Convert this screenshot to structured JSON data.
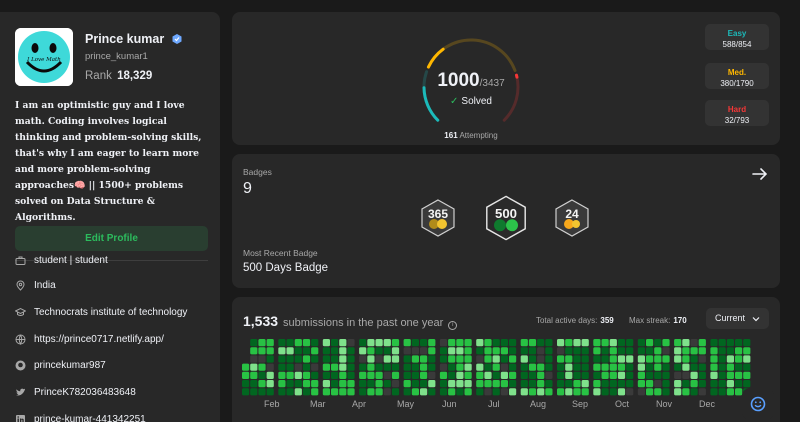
{
  "profile": {
    "name": "Prince kumar",
    "username": "prince_kumar1",
    "rank_label": "Rank",
    "rank_value": "18,329",
    "avatar_caption": "I Love Math",
    "bio": "I am an optimistic guy and I love math. Coding involves logical thinking and problem-solving skills, that's why I am eager to learn more and more problem-solving approaches🧠 || 1500+ problems solved on Data Structure & Algorithms.",
    "edit_button": "Edit Profile",
    "info": [
      {
        "icon": "briefcase-icon",
        "text": "student | student"
      },
      {
        "icon": "location-icon",
        "text": "India"
      },
      {
        "icon": "graduation-cap-icon",
        "text": "Technocrats institute of technology"
      },
      {
        "icon": "globe-icon",
        "text": "https://prince0717.netlify.app/"
      },
      {
        "icon": "github-icon",
        "text": "princekumar987"
      },
      {
        "icon": "twitter-icon",
        "text": "PrinceK782036483648"
      },
      {
        "icon": "linkedin-icon",
        "text": "prince-kumar-441342251"
      }
    ]
  },
  "solved": {
    "solved_count": "1000",
    "total": "/3437",
    "solved_label": "Solved",
    "attempting_count": "161",
    "attempting_label": "Attempting",
    "colors": {
      "easy": "#1cbaba",
      "medium": "#ffb700",
      "hard": "#f63737"
    },
    "difficulties": [
      {
        "label": "Easy",
        "value": "588/854",
        "solved": 588,
        "total": 854,
        "color": "#1cbaba"
      },
      {
        "label": "Med.",
        "value": "380/1790",
        "solved": 380,
        "total": 1790,
        "color": "#ffb700"
      },
      {
        "label": "Hard",
        "value": "32/793",
        "solved": 32,
        "total": 793,
        "color": "#f63737"
      }
    ]
  },
  "badges": {
    "label": "Badges",
    "count": "9",
    "items": [
      {
        "icon": "365-days-badge-icon",
        "text": "365"
      },
      {
        "icon": "500-days-badge-icon",
        "text": "500"
      },
      {
        "icon": "2024-badge-icon",
        "text": "24"
      }
    ],
    "recent_label": "Most Recent Badge",
    "recent_value": "500 Days Badge"
  },
  "submissions": {
    "count": "1,533",
    "title_suffix": "submissions in the past one year",
    "active_days_label": "Total active days:",
    "active_days": "359",
    "max_streak_label": "Max streak:",
    "max_streak": "170",
    "period": "Current",
    "months": [
      "Feb",
      "Mar",
      "Apr",
      "May",
      "Jun",
      "Jul",
      "Aug",
      "Sep",
      "Oct",
      "Nov",
      "Dec"
    ],
    "heat_colors": [
      "#3a3a3a",
      "#016620",
      "#28c244",
      "#7fe18b"
    ]
  }
}
